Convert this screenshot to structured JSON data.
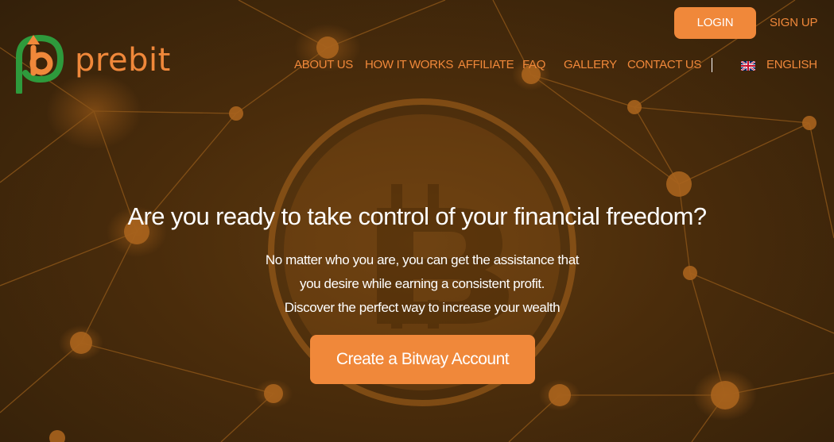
{
  "brand": {
    "name": "prebit",
    "logo_letter": "b",
    "colors": {
      "orange": "#f0883a",
      "green": "#2e9a3c",
      "background": "#4a2c0b"
    }
  },
  "header": {
    "login_label": "LOGIN",
    "signup_label": "SIGN UP",
    "nav": [
      {
        "label": "ABOUT US"
      },
      {
        "label": "HOW IT WORKS"
      },
      {
        "label": "AFFILIATE"
      },
      {
        "label": "FAQ"
      },
      {
        "label": "GALLERY"
      },
      {
        "label": "CONTACT US"
      }
    ],
    "language": {
      "label": "ENGLISH",
      "flag_icon": "uk-flag-icon"
    }
  },
  "hero": {
    "title": "Are you ready to take control of your financial freedom?",
    "lines": [
      "No matter who you are, you can get the assistance that",
      "you desire while earning a consistent profit.",
      "Discover the perfect way to increase your wealth"
    ],
    "cta_label": "Create a Bitway Account",
    "background_icon": "bitcoin-network-icon"
  }
}
